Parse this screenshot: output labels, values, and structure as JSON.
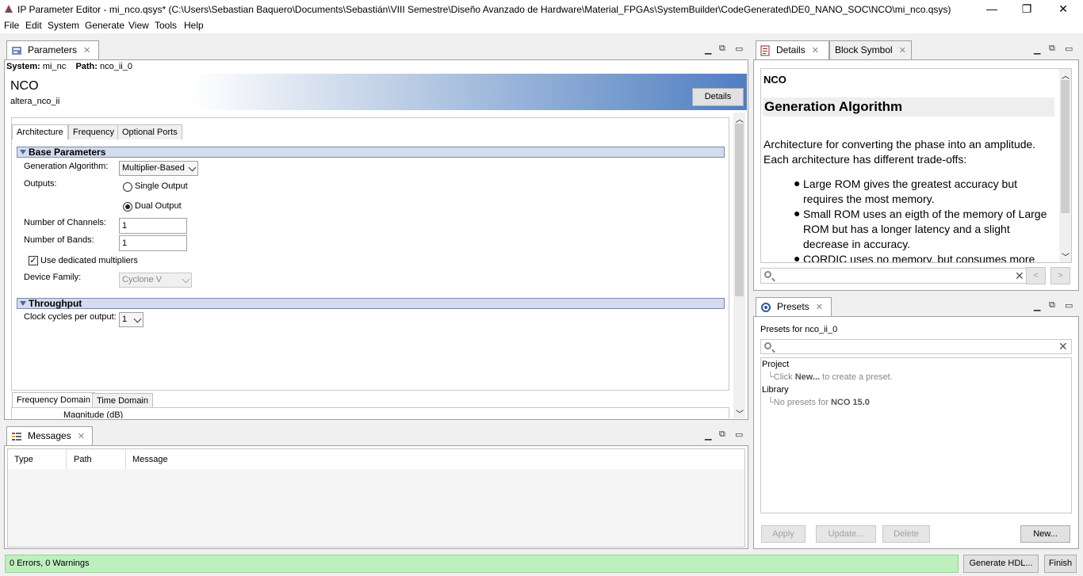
{
  "window": {
    "title": "IP Parameter Editor - mi_nco.qsys* (C:\\Users\\Sebastian Baquero\\Documents\\Sebastián\\VIII Semestre\\Diseño Avanzado de Hardware\\Material_FPGAs\\SystemBuilder\\CodeGenerated\\DE0_NANO_SOC\\NCO\\mi_nco.qsys)",
    "min": "—",
    "max": "❐",
    "close": "✕"
  },
  "menu": [
    "File",
    "Edit",
    "System",
    "Generate",
    "View",
    "Tools",
    "Help"
  ],
  "parameters": {
    "tab": "Parameters",
    "system_label": "System:",
    "system_value": "mi_nc",
    "path_label": "Path:",
    "path_value": "nco_ii_0",
    "component_title": "NCO",
    "component_sub": "altera_nco_ii",
    "details_button": "Details",
    "tabs": [
      "Architecture",
      "Frequency",
      "Optional Ports"
    ],
    "base_section": "Base Parameters",
    "gen_alg_label": "Generation Algorithm:",
    "gen_alg_value": "Multiplier-Based",
    "outputs_label": "Outputs:",
    "single_output": "Single Output",
    "dual_output": "Dual Output",
    "channels_label": "Number of Channels:",
    "channels_value": "1",
    "bands_label": "Number of Bands:",
    "bands_value": "1",
    "dedicated_mult": "Use dedicated multipliers",
    "device_family_label": "Device Family:",
    "device_family_value": "Cyclone V",
    "throughput_section": "Throughput",
    "clock_label": "Clock cycles per output:",
    "clock_value": "1",
    "bottom_tabs": [
      "Frequency Domain",
      "Time Domain"
    ],
    "magnitude_label": "Magnitude (dB)"
  },
  "details": {
    "tabs": [
      "Details",
      "Block Symbol"
    ],
    "title": "NCO",
    "heading": "Generation Algorithm",
    "para1": "Architecture for converting the phase into an amplitude.",
    "para2": "Each architecture has different trade-offs:",
    "bullets": [
      {
        "l1": "Large ROM gives the greatest accuracy but",
        "l2": "requires the most memory."
      },
      {
        "l1": "Small ROM uses an eigth of the memory of Large",
        "l2": "ROM but has a longer latency and a slight",
        "l3": "decrease in accuracy."
      },
      {
        "l1": "CORDIC uses no memory, but consumes more"
      }
    ],
    "prev": "<",
    "next": ">"
  },
  "presets": {
    "tab": "Presets",
    "for_label": "Presets for nco_ii_0",
    "project": "Project",
    "project_pre": "Click ",
    "project_new": "New...",
    "project_post": " to create a preset.",
    "library": "Library",
    "library_pre": "No presets for ",
    "library_name": "NCO 15.0",
    "apply": "Apply",
    "update": "Update...",
    "delete": "Delete",
    "new": "New..."
  },
  "messages": {
    "tab": "Messages",
    "cols": [
      "Type",
      "Path",
      "Message"
    ]
  },
  "status": {
    "text": "0 Errors, 0 Warnings",
    "generate": "Generate HDL...",
    "finish": "Finish"
  }
}
